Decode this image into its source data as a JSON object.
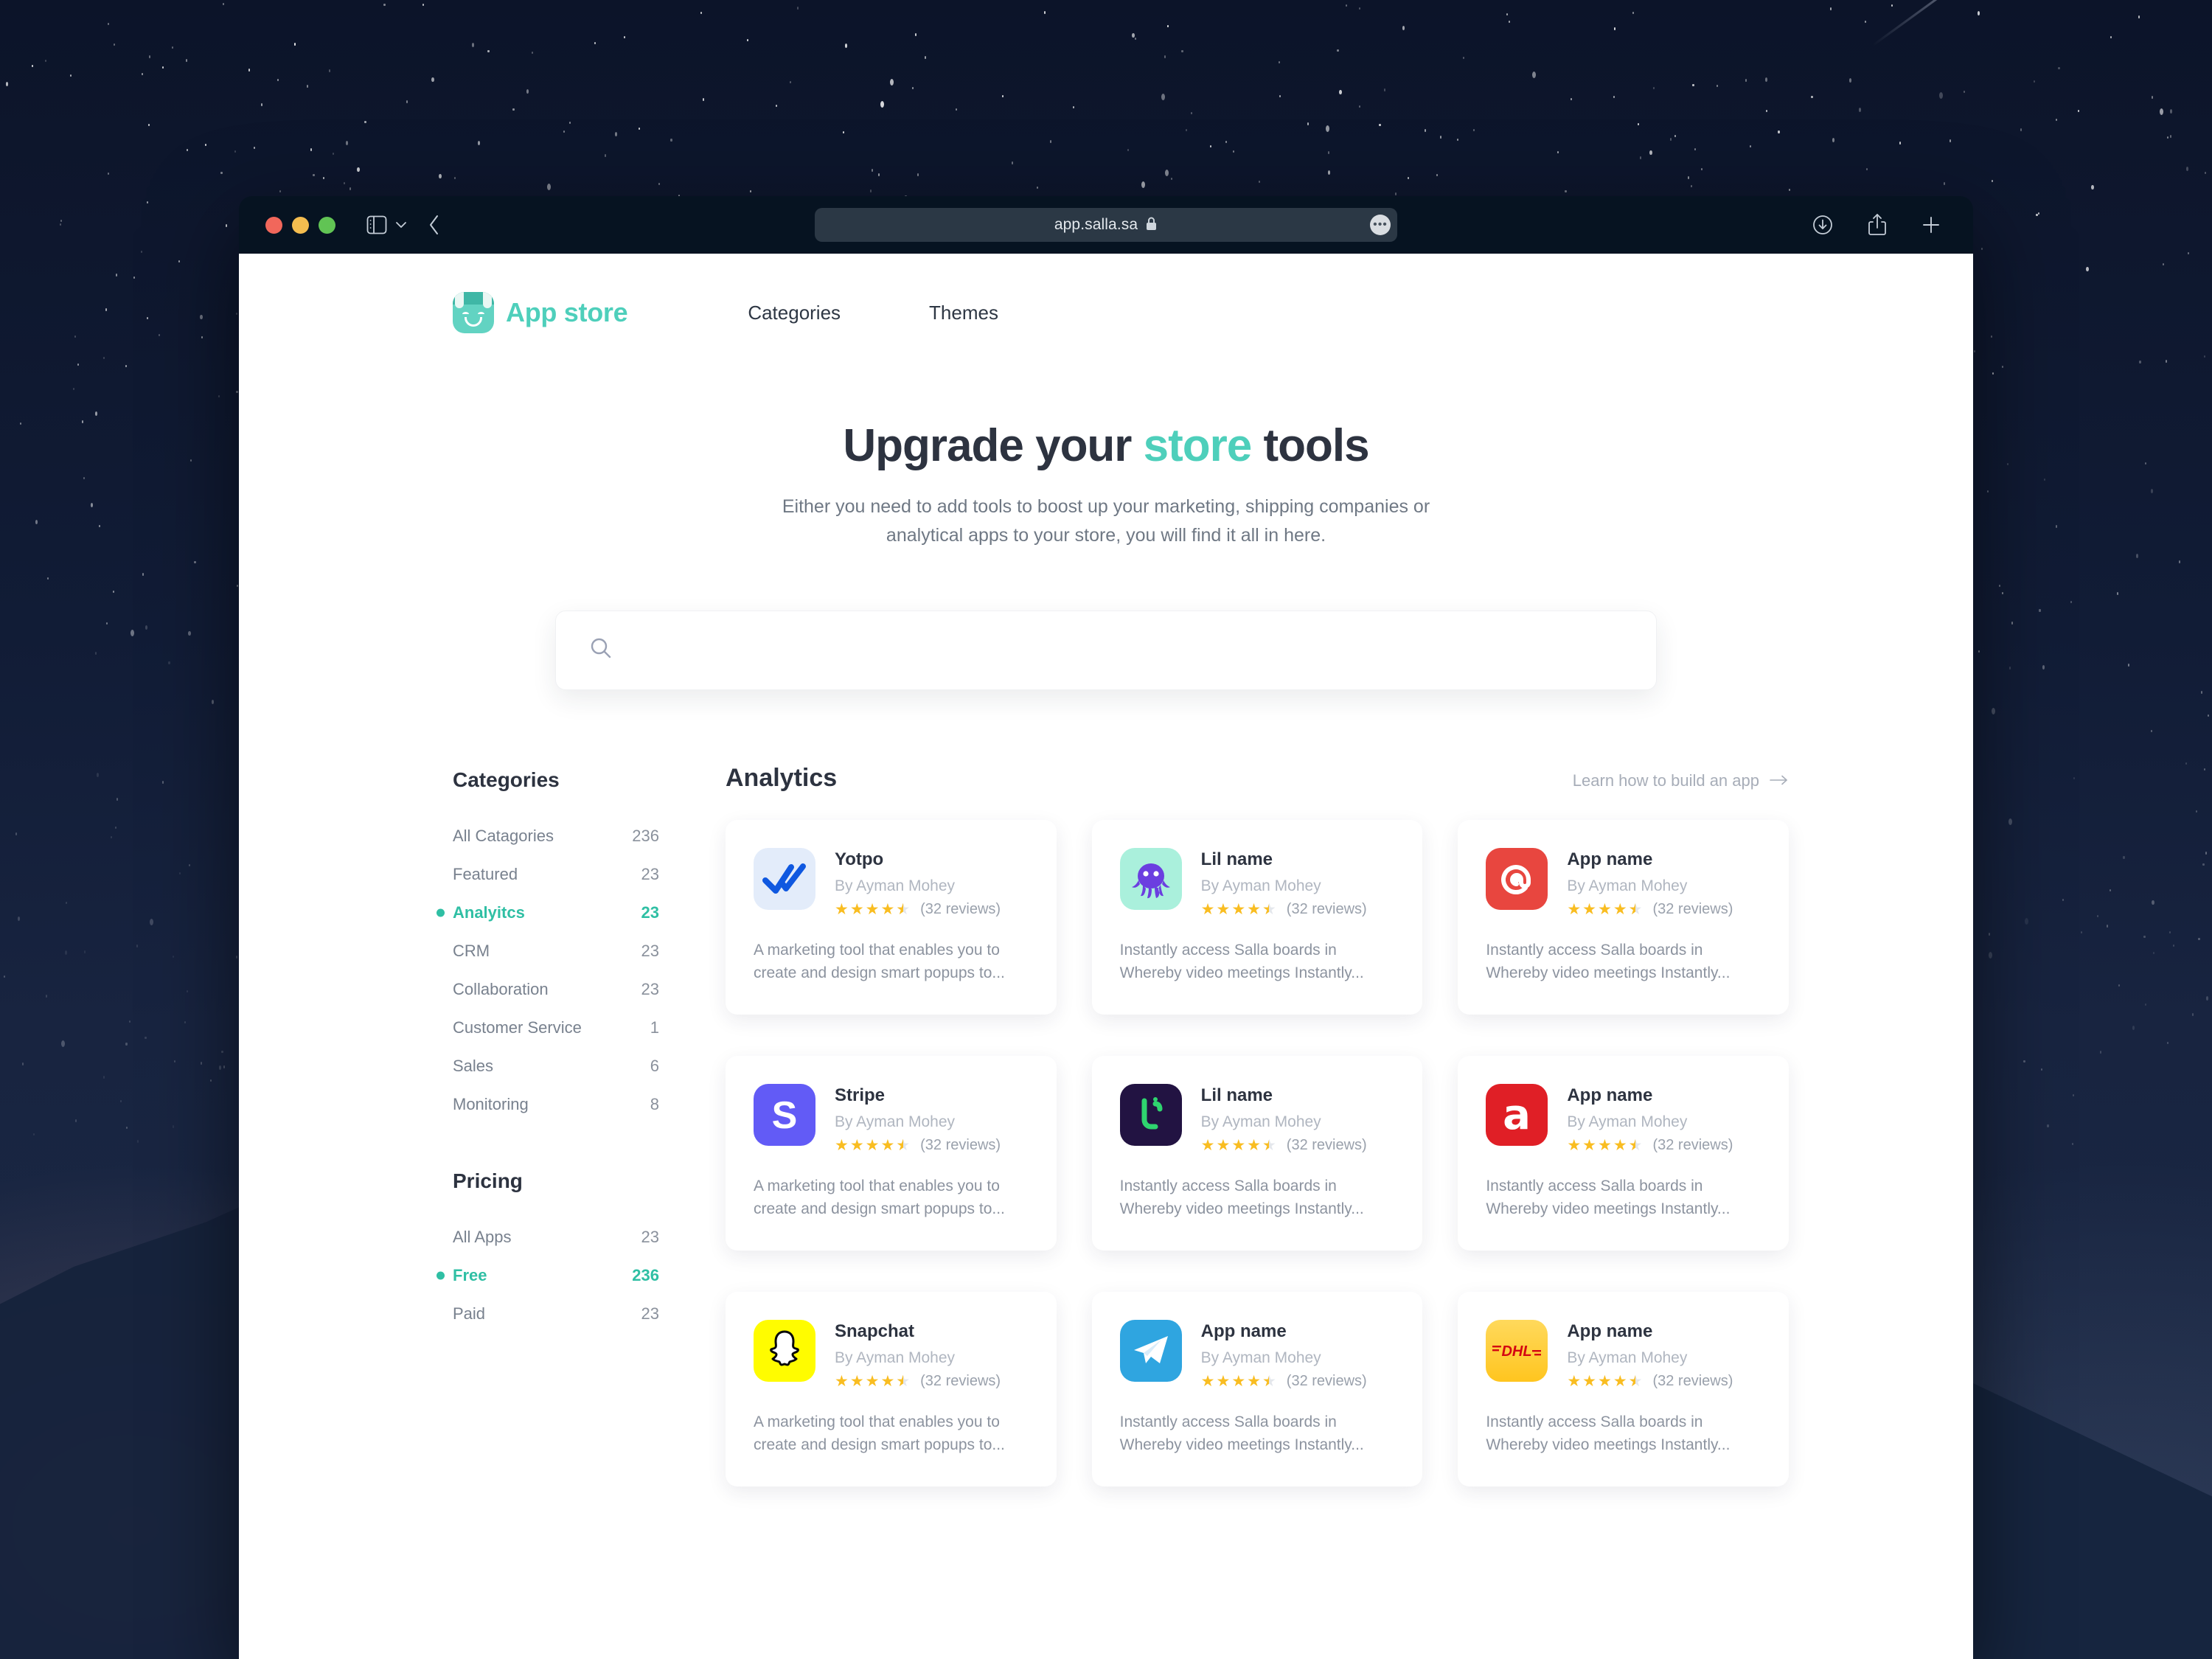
{
  "browser": {
    "url": "app.salla.sa",
    "lock_icon": "lock-icon",
    "traffic_lights": [
      "close",
      "minimize",
      "maximize"
    ],
    "toolbar_icons": [
      "sidebar-icon",
      "chevron-down-icon",
      "back-icon",
      "downloads-icon",
      "share-icon",
      "new-tab-icon"
    ],
    "url_more_label": "•••"
  },
  "header": {
    "logo_text": "App store",
    "logo_icon": "app-store-smiley-bag-icon",
    "nav": [
      {
        "label": "Categories"
      },
      {
        "label": "Themes"
      }
    ]
  },
  "hero": {
    "title_part1": "Upgrade your ",
    "title_accent": "store",
    "title_part2": " tools",
    "subtitle": "Either you need to add tools to boost up your marketing, shipping companies or analytical apps to your store, you will find it all in here."
  },
  "search": {
    "value": "",
    "placeholder": "",
    "icon": "search-icon"
  },
  "sidebar": {
    "categories_title": "Categories",
    "categories": [
      {
        "label": "All Catagories",
        "count": "236",
        "active": false
      },
      {
        "label": "Featured",
        "count": "23",
        "active": false
      },
      {
        "label": "Analyitcs",
        "count": "23",
        "active": true
      },
      {
        "label": "CRM",
        "count": "23",
        "active": false
      },
      {
        "label": "Collaboration",
        "count": "23",
        "active": false
      },
      {
        "label": "Customer Service",
        "count": "1",
        "active": false
      },
      {
        "label": "Sales",
        "count": "6",
        "active": false
      },
      {
        "label": "Monitoring",
        "count": "8",
        "active": false
      }
    ],
    "pricing_title": "Pricing",
    "pricing": [
      {
        "label": "All Apps",
        "count": "23",
        "active": false
      },
      {
        "label": "Free",
        "count": "236",
        "active": true
      },
      {
        "label": "Paid",
        "count": "23",
        "active": false
      }
    ]
  },
  "main": {
    "section_title": "Analytics",
    "learn_link": "Learn how to build an app",
    "learn_link_icon": "arrow-right-icon",
    "cards": [
      {
        "name": "Yotpo",
        "author": "By Ayman Mohey",
        "rating": 4.5,
        "reviews": "(32 reviews)",
        "description": "A marketing tool that enables you to create and design smart popups to...",
        "icon": "double-check-icon",
        "icon_bg": "#e3ecfa",
        "icon_fg": "#0f58e0"
      },
      {
        "name": "Lil name",
        "author": "By Ayman Mohey",
        "rating": 4.5,
        "reviews": "(32 reviews)",
        "description": "Instantly access Salla boards in Whereby video meetings Instantly...",
        "icon": "octopus-icon",
        "icon_bg": "#aaf0dc",
        "icon_fg": "#6b3ee0"
      },
      {
        "name": "App name",
        "author": "By Ayman Mohey",
        "rating": 4.5,
        "reviews": "(32 reviews)",
        "description": "Instantly access Salla boards in Whereby video meetings Instantly...",
        "icon": "at-spiral-icon",
        "icon_bg": "#e8463f",
        "icon_fg": "#ffffff"
      },
      {
        "name": "Stripe",
        "author": "By Ayman Mohey",
        "rating": 4.5,
        "reviews": "(32 reviews)",
        "description": "A marketing tool that enables you to create and design smart popups to...",
        "icon": "stripe-s-icon",
        "icon_bg": "#625bf6",
        "icon_fg": "#ffffff"
      },
      {
        "name": "Lil name",
        "author": "By Ayman Mohey",
        "rating": 4.5,
        "reviews": "(32 reviews)",
        "description": "Instantly access Salla boards in Whereby video meetings Instantly...",
        "icon": "salla-glyph-icon",
        "icon_bg": "#221342",
        "icon_fg": "#2fd46f"
      },
      {
        "name": "App name",
        "author": "By Ayman Mohey",
        "rating": 4.5,
        "reviews": "(32 reviews)",
        "description": "Instantly access Salla boards in Whereby video meetings Instantly...",
        "icon": "letter-a-icon",
        "icon_bg": "#e01f26",
        "icon_fg": "#ffffff"
      },
      {
        "name": "Snapchat",
        "author": "By Ayman Mohey",
        "rating": 4.5,
        "reviews": "(32 reviews)",
        "description": "A marketing tool that enables you to create and design smart popups to...",
        "icon": "snapchat-ghost-icon",
        "icon_bg": "#fffc00",
        "icon_fg": "#ffffff"
      },
      {
        "name": "App name",
        "author": "By Ayman Mohey",
        "rating": 4.5,
        "reviews": "(32 reviews)",
        "description": "Instantly access Salla boards in Whereby video meetings Instantly...",
        "icon": "telegram-plane-icon",
        "icon_bg": "#2fa5e0",
        "icon_fg": "#ffffff"
      },
      {
        "name": "App name",
        "author": "By Ayman Mohey",
        "rating": 4.5,
        "reviews": "(32 reviews)",
        "description": "Instantly access Salla boards in Whereby video meetings Instantly...",
        "icon": "dhl-icon",
        "icon_bg": "#ffcc2a",
        "icon_fg": "#d40511"
      }
    ]
  },
  "colors": {
    "accent": "#4ecfbb",
    "accent_active": "#2fbfa4",
    "text_dark": "#2d3340",
    "text_muted": "#8c939f",
    "star": "#f9bd21"
  }
}
